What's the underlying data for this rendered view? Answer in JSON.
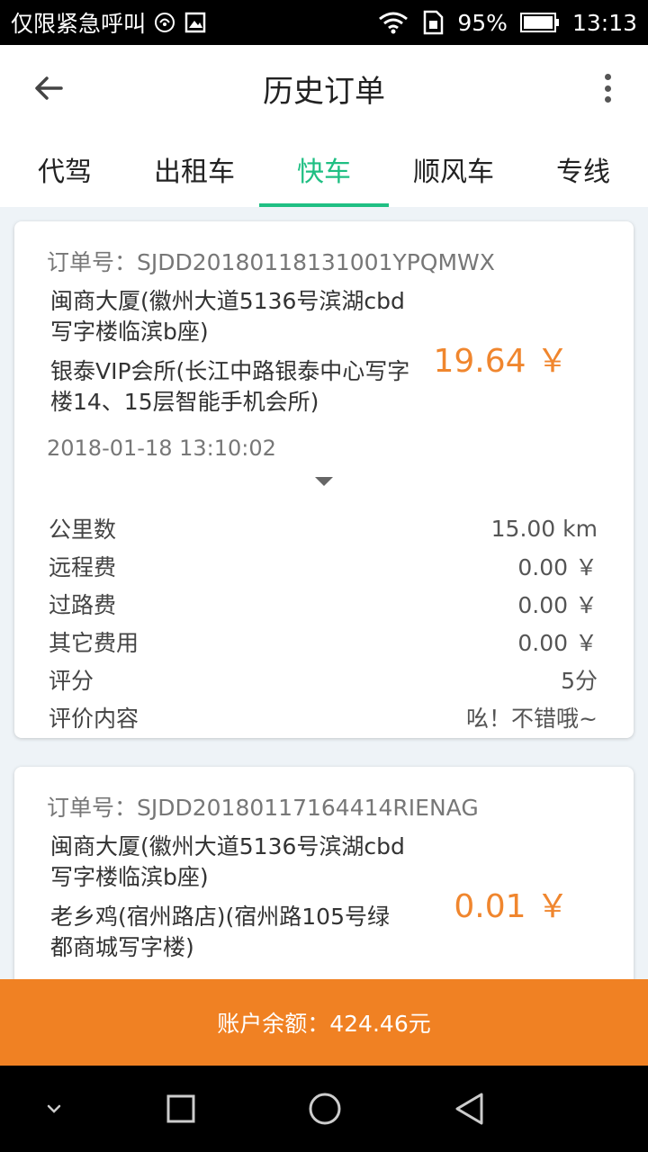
{
  "status_bar": {
    "carrier": "仅限紧急呼叫",
    "battery": "95%",
    "time": "13:13",
    "icons": [
      "nfc-icon",
      "image-icon",
      "wifi-icon",
      "sim-icon",
      "battery-icon"
    ]
  },
  "app_bar": {
    "title": "历史订单",
    "back_icon": "arrow-left-icon",
    "more_icon": "more-vertical-icon"
  },
  "tabs": [
    {
      "label": "代驾",
      "active": false
    },
    {
      "label": "出租车",
      "active": false
    },
    {
      "label": "快车",
      "active": true
    },
    {
      "label": "顺风车",
      "active": false
    },
    {
      "label": "专线",
      "active": false
    }
  ],
  "orders": [
    {
      "order_no": "订单号：SJDD20180118131001YPQMWX",
      "from": "闽商大厦(徽州大道5136号滨湖cbd写字楼临滨b座)",
      "to": "银泰VIP会所(长江中路银泰中心写字楼14、15层智能手机会所)",
      "price": "19.64 ￥",
      "time": "2018-01-18 13:10:02",
      "details": [
        {
          "label": "公里数",
          "value": "15.00 km"
        },
        {
          "label": "远程费",
          "value": "0.00 ￥"
        },
        {
          "label": "过路费",
          "value": "0.00 ￥"
        },
        {
          "label": "其它费用",
          "value": "0.00 ￥"
        },
        {
          "label": "评分",
          "value": "5分"
        },
        {
          "label": "评价内容",
          "value": "吆！不错哦~"
        }
      ]
    },
    {
      "order_no": "订单号：SJDD20180117164414RIENAG",
      "from": "闽商大厦(徽州大道5136号滨湖cbd写字楼临滨b座)",
      "to": "老乡鸡(宿州路店)(宿州路105号绿都商城写字楼)",
      "price": "0.01 ￥"
    }
  ],
  "balance": "账户余额：424.46元",
  "nav_bar": {
    "icons": [
      "chevron-down-icon",
      "recents-square-icon",
      "home-circle-icon",
      "back-triangle-icon"
    ]
  },
  "colors": {
    "accent": "#1fbf83",
    "price": "#f0862e",
    "balance_bar": "#f08123"
  }
}
